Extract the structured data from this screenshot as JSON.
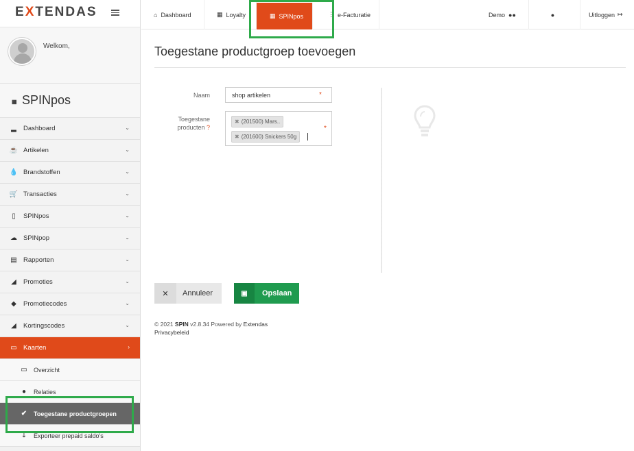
{
  "brand": {
    "pre": "E",
    "x": "X",
    "post": "TENDAS"
  },
  "user": {
    "welcome": "Welkom,"
  },
  "app": {
    "title": "SPINpos",
    "icon": "grid-icon"
  },
  "sidebar": {
    "items": [
      {
        "label": "Dashboard",
        "icon": "bar-chart-icon"
      },
      {
        "label": "Artikelen",
        "icon": "cup-icon"
      },
      {
        "label": "Brandstoffen",
        "icon": "drop-icon"
      },
      {
        "label": "Transacties",
        "icon": "cart-icon"
      },
      {
        "label": "SPINpos",
        "icon": "mobile-icon"
      },
      {
        "label": "SPINpop",
        "icon": "cloud-download-icon"
      },
      {
        "label": "Rapporten",
        "icon": "inbox-icon"
      },
      {
        "label": "Promoties",
        "icon": "bullhorn-icon"
      },
      {
        "label": "Promotiecodes",
        "icon": "tag-icon"
      },
      {
        "label": "Kortingscodes",
        "icon": "bullhorn-icon"
      },
      {
        "label": "Kaarten",
        "icon": "credit-card-icon"
      }
    ],
    "subitems": [
      {
        "label": "Overzicht",
        "icon": "card-icon"
      },
      {
        "label": "Relaties",
        "icon": "users-icon"
      },
      {
        "label": "Toegestane productgroepen",
        "icon": "check-circle-icon"
      },
      {
        "label": "Exporteer prepaid saldo's",
        "icon": "download-icon"
      }
    ]
  },
  "topbar": {
    "tabs": [
      {
        "label": "Dashboard",
        "icon": "home-icon"
      },
      {
        "label": "Loyalty",
        "icon": "grid-icon"
      },
      {
        "label": "SPINpos",
        "icon": "grid-icon"
      },
      {
        "label": "e-Facturatie",
        "icon": "grid-icon"
      }
    ],
    "demo": "Demo",
    "logout": "Uitloggen"
  },
  "page": {
    "title": "Toegestane productgroep toevoegen",
    "name_label": "Naam",
    "name_value": "shop artikelen",
    "products_label_1": "Toegestane",
    "products_label_2": "producten",
    "products_help": "?",
    "required_mark": "*",
    "tags": [
      "(201500) Mars..",
      "(201600) Snickers 50g"
    ]
  },
  "buttons": {
    "cancel": "Annuleer",
    "save": "Opslaan"
  },
  "footer": {
    "copyright_pre": "© 2021",
    "product": "SPIN",
    "version": "v2.8.34 Powered by",
    "company": "Extendas",
    "privacy": "Privacybeleid"
  },
  "colors": {
    "accent": "#e04a1a",
    "save": "#1f9b4f",
    "highlight": "#2eaa4a"
  }
}
